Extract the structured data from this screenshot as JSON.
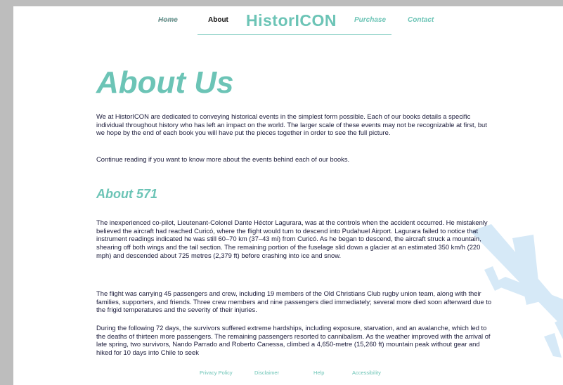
{
  "nav": {
    "home": "Home",
    "about": "About",
    "logo": "HistorICON",
    "purchase": "Purchase",
    "contact": "Contact"
  },
  "main": {
    "title": "About Us",
    "intro": "We at HistorICON are dedicated to conveying historical events in the simplest form possible. Each of our books details a specific individual throughout history who has left an impact on the world. The larger scale of these events may not be recognizable at first, but we hope by the end of each book you will have put the pieces together in order to see the full picture.",
    "intro2": "Continue reading if you want to know more about the events behind each of our books.",
    "section_title": "About 571",
    "paragraphs": [
      "The inexperienced co-pilot, Lieutenant-Colonel Dante Héctor Lagurara, was at the controls when the accident occurred. He mistakenly believed the aircraft had reached Curicó, where the flight would turn to descend into Pudahuel Airport. Lagurara failed to notice that instrument readings indicated he was still 60–70 km (37–43 mi) from Curicó. As he began to descend, the aircraft struck a mountain, shearing off both wings and the tail section. The remaining portion of the fuselage slid down a glacier at an estimated 350 km/h (220 mph) and descended about 725 metres (2,379 ft) before crashing into ice and snow.",
      "The flight was carrying 45 passengers and crew, including 19 members of the Old Christians Club rugby union team, along with their families, supporters, and friends. Three crew members and nine passengers died immediately; several more died soon afterward due to the frigid temperatures and the severity of their injuries.",
      "During the following 72 days, the survivors suffered extreme hardships, including exposure, starvation, and an avalanche, which led to the deaths of thirteen more passengers. The remaining passengers resorted to cannibalism. As the weather improved with the arrival of late spring, two survivors, Nando Parrado and Roberto Canessa, climbed a 4,650-metre (15,260 ft) mountain peak without gear and hiked for 10 days into Chile to seek"
    ]
  },
  "footer": {
    "privacy": "Privacy Policy",
    "disclaimer": "Disclaimer",
    "help": "Help",
    "accessibility": "Accessibility"
  },
  "colors": {
    "accent": "#6cc4b6",
    "text": "#1a1a3a",
    "plane": "#d6e9f7",
    "background": "#bdbdbd"
  }
}
